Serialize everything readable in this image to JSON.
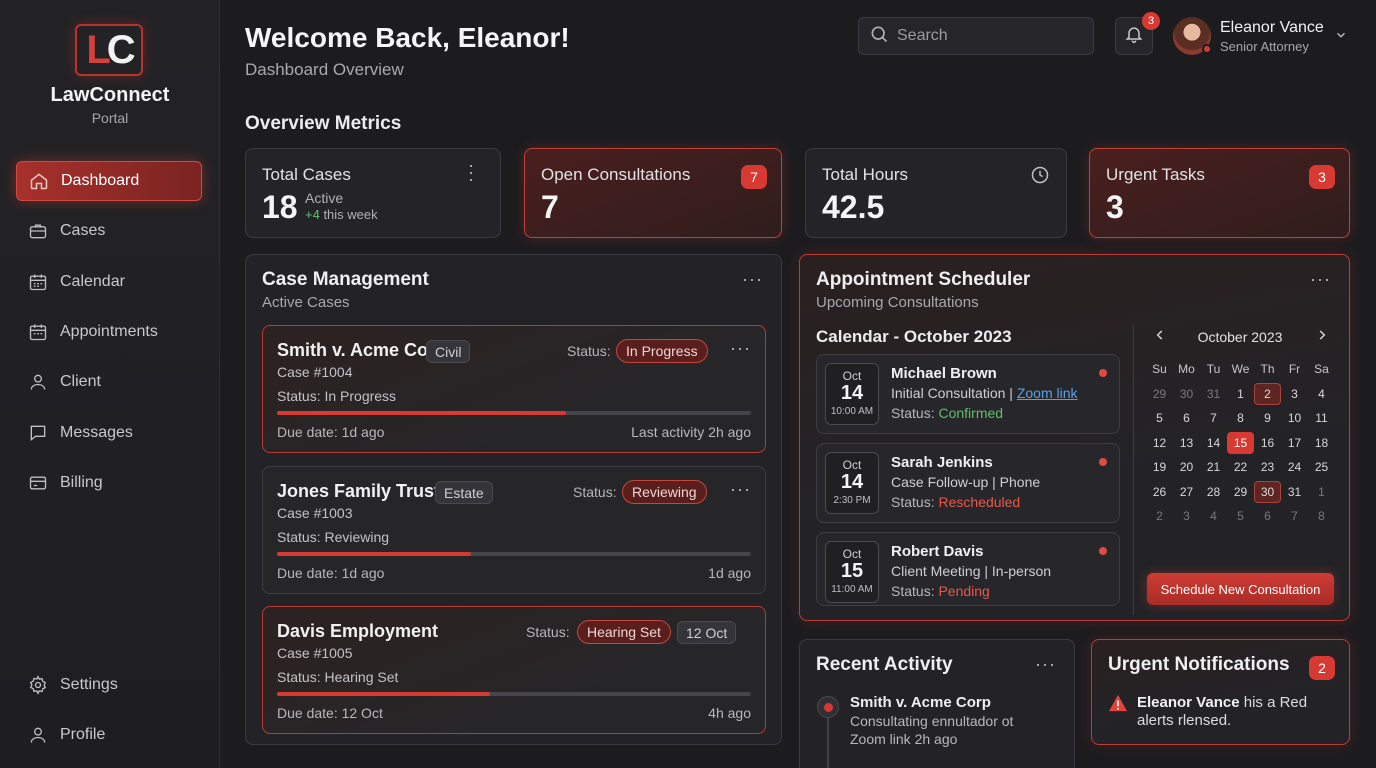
{
  "sidebar": {
    "logo_l": "L",
    "logo_c": "C",
    "brand": "LawConnect",
    "brand_sub": "Portal",
    "items": [
      {
        "label": "Dashboard",
        "icon": "home-icon"
      },
      {
        "label": "Cases",
        "icon": "briefcase-icon"
      },
      {
        "label": "Calendar",
        "icon": "calendar-icon"
      },
      {
        "label": "Appointments",
        "icon": "calendar-check-icon"
      },
      {
        "label": "Client",
        "icon": "user-icon"
      },
      {
        "label": "Messages",
        "icon": "chat-icon"
      },
      {
        "label": "Billing",
        "icon": "card-icon"
      }
    ],
    "bottom": [
      {
        "label": "Settings",
        "icon": "gear-icon"
      },
      {
        "label": "Profile",
        "icon": "user-icon"
      }
    ]
  },
  "header": {
    "welcome": "Welcome Back, Eleanor!",
    "subtitle": "Dashboard Overview",
    "search_placeholder": "Search",
    "notif_count": "3",
    "user_name": "Eleanor Vance",
    "user_role": "Senior Attorney"
  },
  "metrics": {
    "title": "Overview Metrics",
    "total_cases": {
      "label": "Total Cases",
      "value": "18",
      "sub1": "Active",
      "sub2_delta": "+4",
      "sub2_rest": " this week"
    },
    "open_consultations": {
      "label": "Open Consultations",
      "value": "7",
      "badge": "7"
    },
    "total_hours": {
      "label": "Total Hours",
      "value": "42.5"
    },
    "urgent_tasks": {
      "label": "Urgent Tasks",
      "value": "3",
      "badge": "3"
    }
  },
  "case_management": {
    "title": "Case Management",
    "subtitle": "Active Cases",
    "status_label": "Status:",
    "cases": [
      {
        "name": "Smith v. Acme Corp",
        "tag": "Civil",
        "number": "Case #1004",
        "status_line": "Status: In Progress",
        "pill": "In Progress",
        "progress": 0.61,
        "due": "Due date: 1d ago",
        "last": "Last activity 2h ago"
      },
      {
        "name": "Jones Family Trust",
        "tag": "Estate",
        "number": "Case #1003",
        "status_line": "Status: Reviewing",
        "pill": "Reviewing",
        "progress": 0.41,
        "due": "Due date: 1d ago",
        "last": "1d ago"
      },
      {
        "name": "Davis Employment",
        "tag": "12 Oct",
        "number": "Case #1005",
        "status_line": "Status: Hearing Set",
        "pill": "Hearing Set",
        "progress": 0.45,
        "due": "Due date: 12 Oct",
        "last": "4h ago"
      }
    ]
  },
  "scheduler": {
    "title": "Appointment Scheduler",
    "subtitle": "Upcoming Consultations",
    "calendar_heading": "Calendar - October 2023",
    "appointments": [
      {
        "mon": "Oct",
        "day": "14",
        "time": "10:00 AM",
        "name": "Michael Brown",
        "type": "Initial Consultation",
        "sep": " | ",
        "link": "Zoom link",
        "status_prefix": "Status: ",
        "status": "Confirmed"
      },
      {
        "mon": "Oct",
        "day": "14",
        "time": "2:30 PM",
        "name": "Sarah Jenkins",
        "type": "Case Follow-up | Phone",
        "status_prefix": "Status: ",
        "status": "Rescheduled"
      },
      {
        "mon": "Oct",
        "day": "15",
        "time": "11:00 AM",
        "name": "Robert Davis",
        "type": "Client Meeting | In-person",
        "status_prefix": "Status: ",
        "status": "Pending"
      }
    ],
    "month": "October 2023",
    "weekdays": [
      "Su",
      "Mo",
      "Tu",
      "We",
      "Th",
      "Fr",
      "Sa"
    ],
    "weeks": [
      [
        "29",
        "30",
        "31",
        "1",
        "2",
        "3",
        "4"
      ],
      [
        "5",
        "6",
        "7",
        "8",
        "9",
        "10",
        "11"
      ],
      [
        "12",
        "13",
        "14",
        "15",
        "16",
        "17",
        "18"
      ],
      [
        "19",
        "20",
        "21",
        "22",
        "23",
        "24",
        "25"
      ],
      [
        "26",
        "27",
        "28",
        "29",
        "30",
        "31",
        "1"
      ],
      [
        "2",
        "3",
        "4",
        "5",
        "6",
        "7",
        "8"
      ]
    ],
    "button": "Schedule New Consultation"
  },
  "recent_activity": {
    "title": "Recent Activity",
    "items": [
      {
        "title": "Smith v. Acme Corp",
        "line1": "Consultating ennultador ot",
        "line2": "Zoom link 2h ago"
      }
    ]
  },
  "urgent_notifications": {
    "title": "Urgent Notifications",
    "badge": "2",
    "name": "Eleanor Vance",
    "text1": " his a Red",
    "text2": "alerts rlensed."
  }
}
